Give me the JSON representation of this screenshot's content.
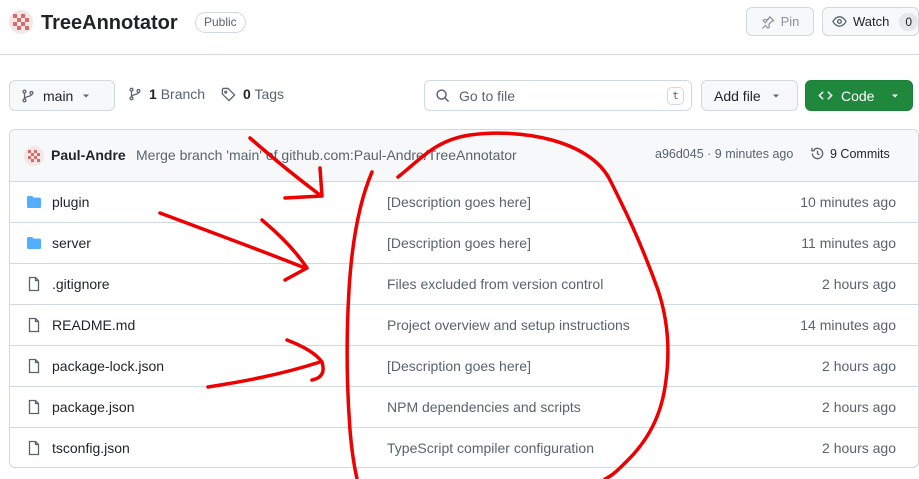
{
  "repo": {
    "name": "TreeAnnotator",
    "visibility": "Public",
    "pin_label": "Pin",
    "watch_label": "Watch",
    "watch_count": "0"
  },
  "toolbar": {
    "branch": "main",
    "branch_count": "1",
    "branch_word": "Branch",
    "tag_count": "0",
    "tag_word": "Tags",
    "search_placeholder": "Go to file",
    "search_shortcut": "t",
    "add_file": "Add file",
    "code": "Code"
  },
  "commit": {
    "author": "Paul-Andre",
    "message": "Merge branch 'main' of github.com:Paul-Andre/TreeAnnotator",
    "meta": "a96d045 · 9 minutes ago",
    "commits_label": "9 Commits"
  },
  "files": [
    {
      "type": "folder",
      "name": "plugin",
      "description": "[Description goes here]",
      "date": "10 minutes ago"
    },
    {
      "type": "folder",
      "name": "server",
      "description": "[Description goes here]",
      "date": "11 minutes ago"
    },
    {
      "type": "file",
      "name": ".gitignore",
      "description": "Files excluded from version control",
      "date": "2 hours ago"
    },
    {
      "type": "file",
      "name": "README.md",
      "description": "Project overview and setup instructions",
      "date": "14 minutes ago"
    },
    {
      "type": "file",
      "name": "package-lock.json",
      "description": "[Description goes here]",
      "date": "2 hours ago"
    },
    {
      "type": "file",
      "name": "package.json",
      "description": "NPM dependencies and scripts",
      "date": "2 hours ago"
    },
    {
      "type": "file",
      "name": "tsconfig.json",
      "description": "TypeScript compiler configuration",
      "date": "2 hours ago"
    }
  ],
  "icons": {
    "folder": "folder-icon",
    "file": "file-icon",
    "branch": "git-branch-icon",
    "tag": "tag-icon",
    "search": "search-icon",
    "pin": "pin-icon",
    "eye": "eye-icon",
    "history": "history-icon",
    "code": "code-icon"
  },
  "colors": {
    "accent_green": "#1f883d",
    "folder_blue": "#54aeff",
    "annotation_red": "#ee0000",
    "border": "#d1d9e0"
  }
}
